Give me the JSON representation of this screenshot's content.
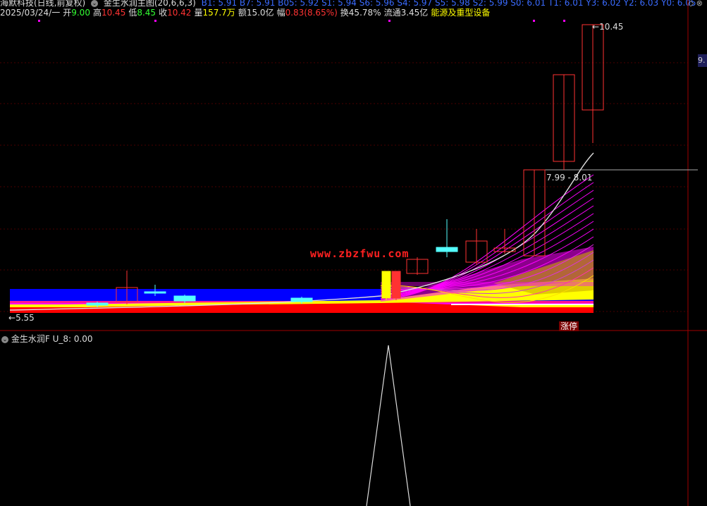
{
  "header": {
    "title": "海默科技(日线,前复权)",
    "indicator_main": "金生水润主图(20,6,6,3)",
    "levels": "B1: 5.91  B7: 5.91  B05: 5.92  S1: 5.94  S6: 5.96  S4: 5.97  S5: 5.98  S2: 5.99  S0: 6.01  T1: 6.01  Y3: 6.02  Y2: 6.03  Y0: 6.05",
    "date": "2025/03/24/一",
    "open_label": "开",
    "open": "9.00",
    "high_label": "高",
    "high": "10.45",
    "low_label": "低",
    "low": "8.45",
    "close_label": "收",
    "close": "10.42",
    "vol_label": "量",
    "vol": "157.7万",
    "amount_label": "额",
    "amount": "15.0亿",
    "chg_label": "幅",
    "chg": "0.83(8.65%)",
    "turnover_label": "换",
    "turnover": "45.78%",
    "float_label": "流通",
    "float": "3.45亿",
    "sector": "能源及重型设备"
  },
  "top_buttons": "◇ ⊗",
  "price_labels": {
    "max": "10.45",
    "min": "5.55",
    "range": "7.99 - 8.01",
    "right_axis": "9."
  },
  "watermark": "www.zbzfwu.com",
  "limit_up": "涨停",
  "sub_indicator": {
    "name": "金生水润F",
    "value_text": "U_8: 0.00"
  },
  "colors": {
    "bg": "#000000",
    "up": "#ff3232",
    "down": "#54ffff",
    "ribbon_blue": "#0000ff",
    "grid": "#5a0000"
  }
}
